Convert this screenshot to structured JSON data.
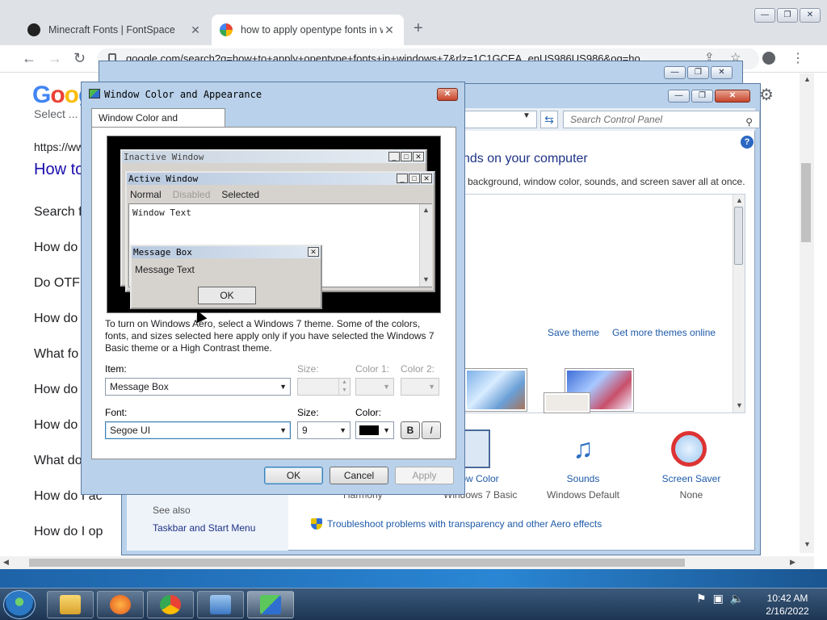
{
  "chrome": {
    "tabs": [
      {
        "title": "Minecraft Fonts | FontSpace",
        "close": "✕"
      },
      {
        "title": "how to apply opentype fonts in w",
        "close": "✕"
      }
    ],
    "new_tab": "+",
    "url": "google.com/search?q=how+to+apply+opentype+fonts+in+windows+7&rlz=1C1GCEA_enUS986US986&oq=ho",
    "window_controls": {
      "min": "—",
      "max": "❐",
      "close": "✕"
    }
  },
  "google": {
    "logo": [
      "G",
      "o",
      "o",
      "g"
    ],
    "select_text": "Select ...",
    "url_text": "https://ww",
    "heading": "How to",
    "questions": [
      "Search f",
      "How do",
      "Do OTF",
      "How do",
      "What fo",
      "How do",
      "How do",
      "What do",
      "How do I ac",
      "How do I op"
    ]
  },
  "back_window": {
    "controls": {
      "min": "—",
      "max": "❐",
      "close": "✕"
    }
  },
  "personalization": {
    "controls": {
      "min": "—",
      "max": "❐",
      "close": "✕"
    },
    "search_placeholder": "Search Control Panel",
    "heading": "nds on your computer",
    "subtitle": "background, window color, sounds, and screen saver all at once.",
    "save_theme": "Save theme",
    "more_themes": "Get more themes online",
    "options": [
      {
        "label": "ow Color",
        "value": "Windows 7 Basic"
      },
      {
        "label": "Sounds",
        "value": "Windows Default"
      },
      {
        "label": "Screen Saver",
        "value": "None"
      }
    ],
    "harmony": "Harmony",
    "see_also": "See also",
    "taskbar_link": "Taskbar and Start Menu",
    "troubleshoot": "Troubleshoot problems with transparency and other Aero effects"
  },
  "dialog": {
    "title": "Window Color and Appearance",
    "tab": "Window Color and Appearance",
    "preview": {
      "inactive": "Inactive Window",
      "active": "Active Window",
      "menu": {
        "normal": "Normal",
        "disabled": "Disabled",
        "selected": "Selected"
      },
      "window_text": "Window Text",
      "msgbox_title": "Message Box",
      "msgbox_text": "Message Text",
      "ok": "OK"
    },
    "aero_text": "To turn on Windows Aero, select a Windows 7 theme.  Some of the colors, fonts, and sizes selected here apply only if you have selected the Windows 7 Basic theme or a High Contrast theme.",
    "labels": {
      "item": "Item:",
      "size": "Size:",
      "color1": "Color 1:",
      "color2": "Color 2:",
      "font": "Font:",
      "font_size": "Size:",
      "color": "Color:"
    },
    "item_value": "Message Box",
    "font_value": "Segoe UI",
    "font_size_value": "9",
    "bold": "B",
    "italic": "I",
    "ok": "OK",
    "cancel": "Cancel",
    "apply": "Apply"
  },
  "taskbar": {
    "clock_time": "10:42 AM",
    "clock_date": "2/16/2022"
  },
  "colors": {
    "chrome_tabbar": "#dee1e6",
    "link": "#1a0dab",
    "win7_frame": "#b9d1ea",
    "cp_link": "#1e5aa8"
  }
}
